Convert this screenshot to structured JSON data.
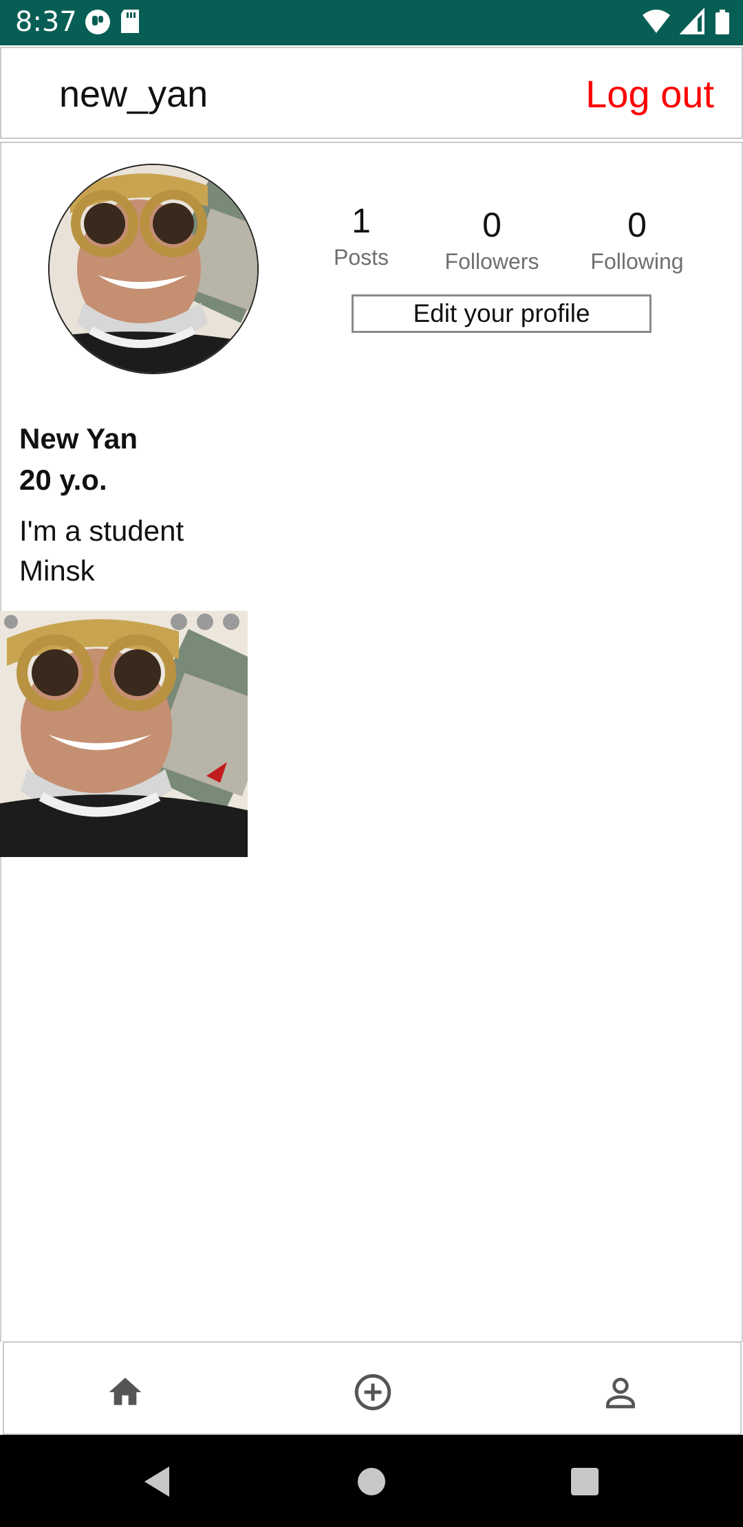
{
  "status_bar": {
    "time": "8:37",
    "background_color": "#075e54",
    "left_icons": [
      "messaging-app-icon",
      "sd-card-icon"
    ],
    "right_icons": [
      "wifi-icon",
      "cell-signal-icon",
      "battery-icon"
    ]
  },
  "header": {
    "username": "new_yan",
    "logout_label": "Log out",
    "logout_color": "#ff0000"
  },
  "profile": {
    "avatar_icon": "profile-photo",
    "stats": {
      "posts": {
        "value": "1",
        "label": "Posts"
      },
      "followers": {
        "value": "0",
        "label": "Followers"
      },
      "following": {
        "value": "0",
        "label": "Following"
      }
    },
    "edit_button_label": "Edit your profile",
    "name": "New Yan",
    "age": "20 y.o.",
    "description": "I'm a student",
    "city": "Minsk"
  },
  "posts": [
    {
      "icon": "post-photo"
    }
  ],
  "bottom_nav": {
    "items": [
      {
        "icon": "home-icon"
      },
      {
        "icon": "add-circle-icon"
      },
      {
        "icon": "person-icon"
      }
    ]
  },
  "system_nav": {
    "buttons": [
      "back-icon",
      "home-circle-icon",
      "recents-icon"
    ]
  }
}
